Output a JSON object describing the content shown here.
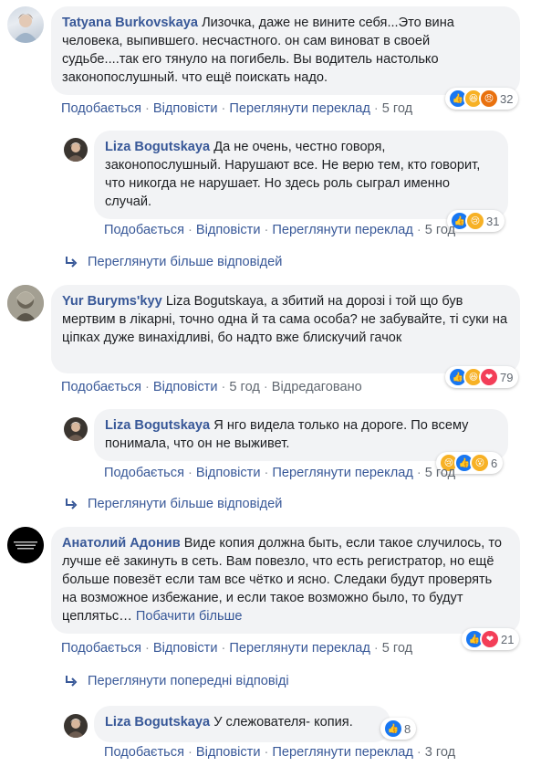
{
  "comments": [
    {
      "author": "Tatyana Burkovskaya",
      "text": "Лизочка, даже не вините себя...Это вина человека, выпившего. несчастного. он сам виноват в своей судьбе....так его тянуло на погибель. Вы водитель настолько законопослушный. что ещё поискать надо.",
      "reactions": {
        "icons": [
          "like",
          "haha",
          "angry"
        ],
        "count": "32"
      },
      "actions": {
        "like": "Подобається",
        "reply": "Відповісти",
        "translate": "Переглянути переклад",
        "time": "5 год"
      },
      "reply": {
        "author": "Liza Bogutskaya",
        "text": "Да не очень, честно говоря, законопослушный. Нарушают все. Не верю тем, кто говорит, что никогда не нарушает. Но здесь роль сыграл именно случай.",
        "reactions": {
          "icons": [
            "like",
            "sad"
          ],
          "count": "31"
        },
        "actions": {
          "like": "Подобається",
          "reply": "Відповісти",
          "translate": "Переглянути переклад",
          "time": "5 год"
        }
      },
      "more_label": "Переглянути більше відповідей"
    },
    {
      "author": "Yur Buryms'kyy",
      "text": "Liza Bogutskaya, а збитий на дорозі і той що був мертвим в лікарні, точно одна й та сама особа? не забувайте, ті суки на ціпках дуже винахідливі, бо надто вже блискучий гачок",
      "reactions": {
        "icons": [
          "like",
          "haha",
          "love"
        ],
        "count": "79"
      },
      "actions": {
        "like": "Подобається",
        "reply": "Відповісти",
        "time": "5 год",
        "edited": "Відредаговано"
      },
      "reply": {
        "author": "Liza Bogutskaya",
        "text": "Я нго видела только на дороге. По всему понимала, что он не выживет.",
        "reactions": {
          "icons": [
            "sad",
            "like",
            "wow"
          ],
          "count": "6"
        },
        "actions": {
          "like": "Подобається",
          "reply": "Відповісти",
          "translate": "Переглянути переклад",
          "time": "5 год"
        }
      },
      "more_label": "Переглянути більше відповідей"
    },
    {
      "author": "Анатолий Адонив",
      "text": "Виде копия должна быть, если такое случилось, то лучше её закинуть в сеть. Вам повезло, что есть регистратор, но ещё больше повезёт если там все чётко и ясно. Следаки будут проверять на возможное избежание, и если такое возможно было, то будут цеплятьс…",
      "see_more": "Побачити більше",
      "reactions": {
        "icons": [
          "like",
          "love"
        ],
        "count": "21"
      },
      "actions": {
        "like": "Подобається",
        "reply": "Відповісти",
        "translate": "Переглянути переклад",
        "time": "5 год"
      },
      "prev_label": "Переглянути попередні відповіді",
      "reply": {
        "author": "Liza Bogutskaya",
        "text": "У слежователя- копия.",
        "reactions": {
          "icons": [
            "like"
          ],
          "count": "8"
        },
        "actions": {
          "like": "Подобається",
          "reply": "Відповісти",
          "translate": "Переглянути переклад",
          "time": "3 год"
        }
      }
    }
  ],
  "colors": {
    "link": "#385898",
    "bubble": "#f2f3f5",
    "meta": "#606770",
    "like": "#1877f2",
    "love": "#f33e58",
    "yellow": "#f7b125"
  }
}
